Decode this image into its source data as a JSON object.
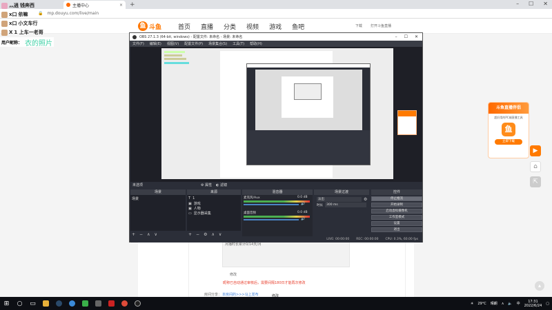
{
  "browser": {
    "tab_title": "主播中心",
    "url": "mp.douyu.com/live/main"
  },
  "chat": {
    "lines": [
      {
        "prefix": "灬逍",
        "text": "钱奔西"
      },
      {
        "prefix": "x口",
        "text": "依嘛"
      },
      {
        "prefix": "x口",
        "text": "小文车行"
      },
      {
        "prefix": "X",
        "text": "1 上车一老哥"
      }
    ],
    "banner_label": "用户昵称：",
    "banner_name": "衣的照片"
  },
  "douyu": {
    "logo_text": "斗鱼",
    "logo_sub": "douyu.com",
    "nav": [
      "首页",
      "直播",
      "分类",
      "视频",
      "游戏",
      "鱼吧"
    ],
    "right": [
      "下载",
      "打开斗鱼直播"
    ]
  },
  "obs": {
    "title": "OBS 27.1.3 (64-bit, windows) - 配置文件: 未命名 - 场景: 未命名",
    "menu": [
      "文件(F)",
      "编辑(E)",
      "视图(V)",
      "配置文件(P)",
      "场景集合(S)",
      "工具(T)",
      "帮助(H)"
    ],
    "scene_label": "未选项",
    "scene_props": "属性",
    "scene_filters": "滤镜",
    "docks": {
      "scenes": "场景",
      "sources": "来源",
      "mixer": "混音器",
      "transitions": "场景过渡",
      "controls": "控件"
    },
    "scene_item": "场景",
    "sources": [
      "1",
      "游戏",
      "人物",
      "显示器采集"
    ],
    "mixer": [
      {
        "name": "麦克风/Aux",
        "db": "0.0 dB"
      },
      {
        "name": "桌面音频",
        "db": "0.0 dB"
      }
    ],
    "transition": "淡出",
    "duration_label": "时长",
    "duration": "300 ms",
    "controls": [
      "停止推流",
      "开始录制",
      "启动虚拟摄像机",
      "工作室模式",
      "设置",
      "退出"
    ],
    "status": [
      "LIVE: 00:00:00",
      "REC: 00:00:00",
      "CPU: 0.3%, 60.00 fps"
    ]
  },
  "page": {
    "amount_text": "月播时长累计0/14天/月",
    "modify_link": "修改",
    "warning": "昵称已自动通过审核后，需要间隔180日才能再次修改",
    "note_label": "房间分享：",
    "note_link": "本房间的>>>马上发布",
    "note_suffix": "修改"
  },
  "promo": {
    "title": "斗鱼直播伴侣",
    "desc": "超好用的PC端直播工具",
    "button": "立即下载"
  },
  "taskbar": {
    "weather": "29°C",
    "weather_desc": "晴朗",
    "lang": "中",
    "time": "17:31",
    "date": "2022/6/24"
  },
  "colors": {
    "accent": "#ff7a00",
    "obs_bg": "#2b2e38",
    "chat_name": "#3fd1a6"
  }
}
